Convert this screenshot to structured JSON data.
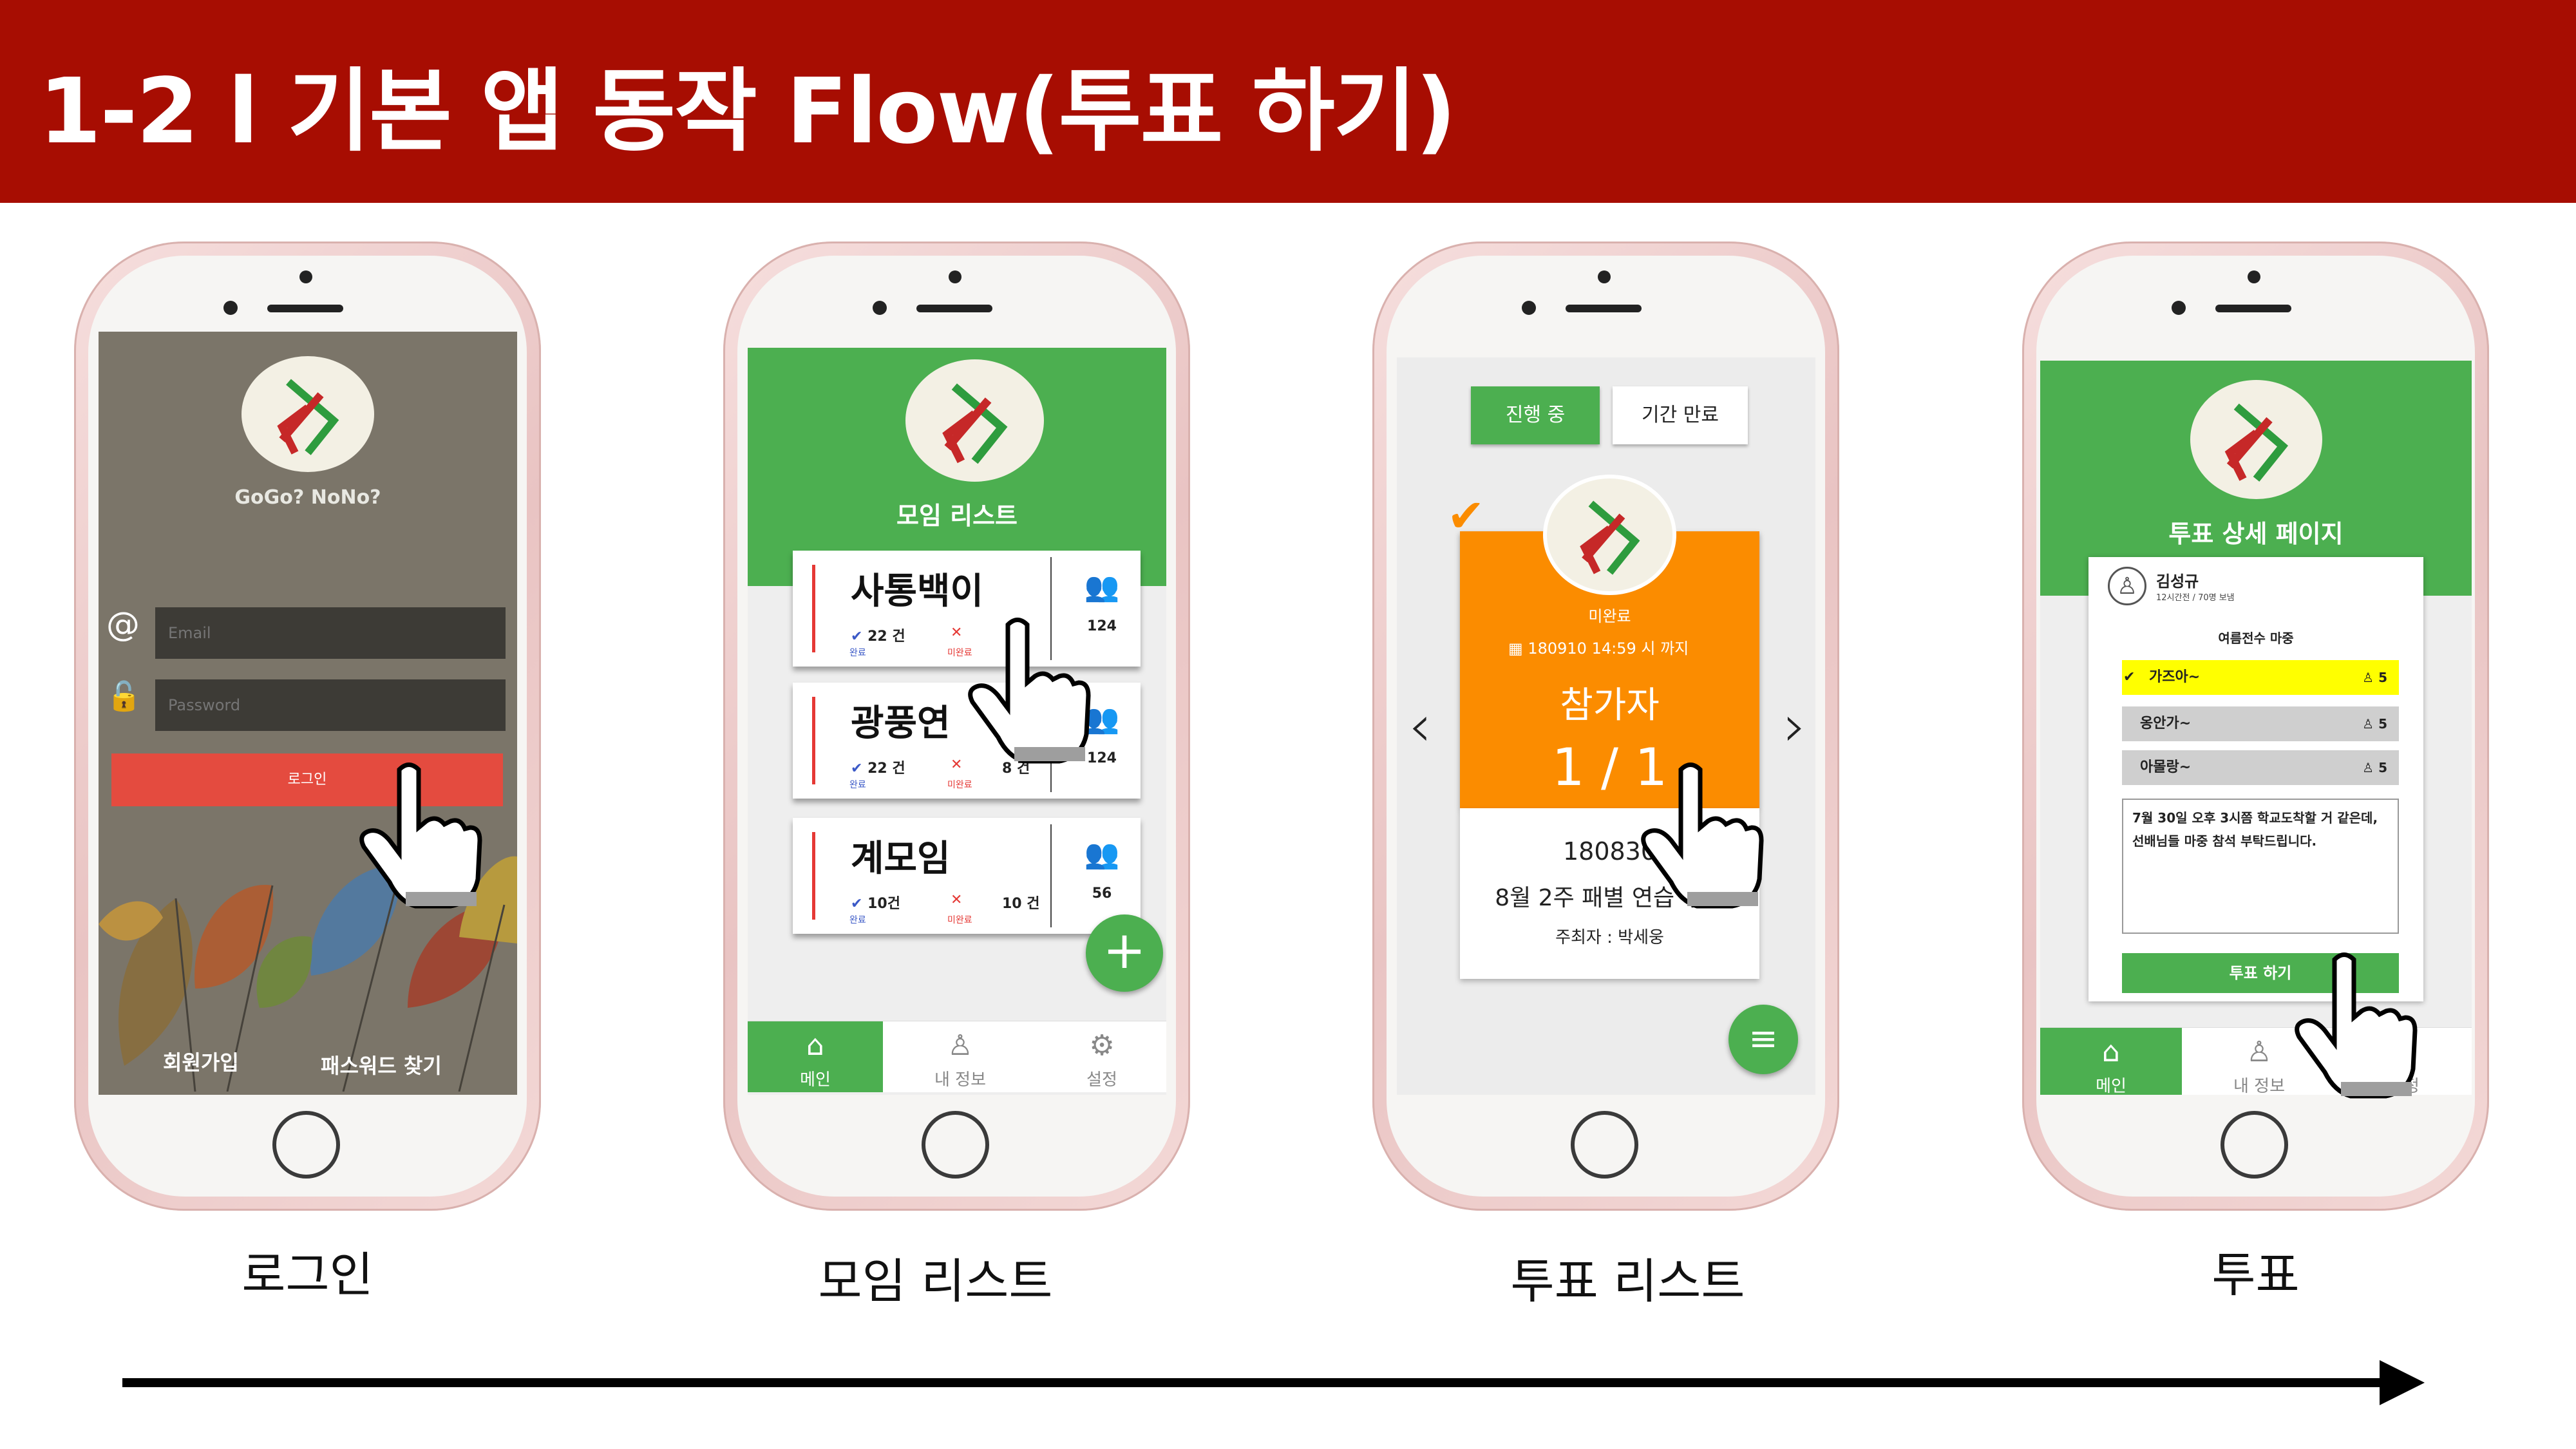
{
  "header": {
    "title": "1-2 l 기본 앱 동작 Flow(투표 하기)"
  },
  "colors": {
    "banner": "#a70d02",
    "green": "#4caf50",
    "orange": "#fb8c00",
    "red": "#e53935"
  },
  "icons": {
    "hand": "pointing-hand-icon",
    "logo": "app-logo-icon"
  },
  "screens": {
    "login": {
      "app_name": "GoGo? NoNo?",
      "email_placeholder": "Email",
      "password_placeholder": "Password",
      "login_button": "로그인",
      "signup_link": "회원가입",
      "find_password_link": "패스워드 찾기",
      "caption": "로그인"
    },
    "group_list": {
      "title": "모임 리스트",
      "groups": [
        {
          "name": "사통백이",
          "done_count": "22 건",
          "done_label": "완료",
          "undone_label": "미완료",
          "undone_count": "",
          "members": "124"
        },
        {
          "name": "광풍연",
          "done_count": "22 건",
          "done_label": "완료",
          "undone_label": "미완료",
          "undone_count": "8 건",
          "members": "124"
        },
        {
          "name": "계모임",
          "done_count": "10건",
          "done_label": "완료",
          "undone_label": "미완료",
          "undone_count": "10 건",
          "members": "56"
        }
      ],
      "add_button": "+",
      "tabs": [
        "메인",
        "내 정보",
        "설정"
      ],
      "caption": "모임 리스트"
    },
    "vote_list": {
      "tab_active": "진행 중",
      "tab_inactive": "기간 만료",
      "status": "미완료",
      "deadline": "180910 14:59 시 까지",
      "participants_label": "참가자",
      "participants": "1 / 1",
      "vote_id": "180830",
      "vote_title": "8월 2주 패별 연습 투표",
      "host": "주최자 : 박세웅",
      "menu_button": "≡",
      "caption": "투표 리스트"
    },
    "vote_detail": {
      "title": "투표 상세 페이지",
      "author_name": "김성규",
      "author_meta": "12시간전 / 70명 보냄",
      "question": "여름전수 마중",
      "options": [
        {
          "label": "가즈아~",
          "count": "5",
          "selected": true
        },
        {
          "label": "옹안가~",
          "count": "5",
          "selected": false
        },
        {
          "label": "아몰랑~",
          "count": "5",
          "selected": false
        }
      ],
      "comment": "7월 30일 오후 3시쯤 학교도착할 거 같은데, 선배님들 마중 참석 부탁드립니다.",
      "vote_button": "투표 하기",
      "tabs": [
        "메인",
        "내 정보",
        "설정"
      ],
      "caption": "투표"
    }
  }
}
